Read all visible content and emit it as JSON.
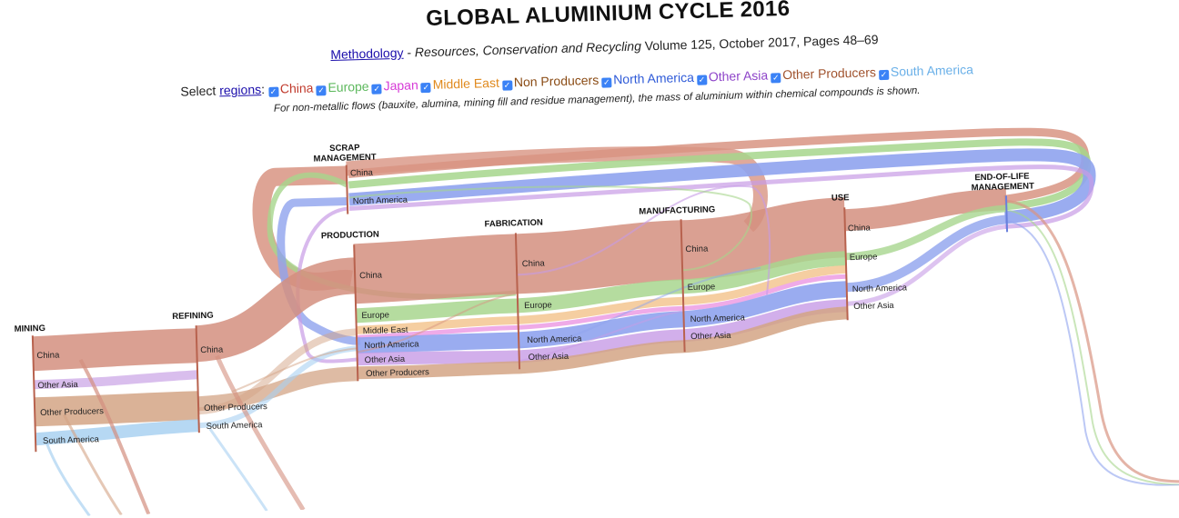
{
  "header": {
    "title": "GLOBAL ALUMINIUM CYCLE 2016",
    "methodology_link": "Methodology",
    "citation_journal": "Resources, Conservation and Recycling",
    "citation_rest": "Volume 125, October 2017, Pages 48–69",
    "select_label": "Select",
    "regions_link": "regions",
    "note": "For non-metallic flows (bauxite, alumina, mining fill and residue management), the mass of aluminium within chemical compounds is shown."
  },
  "regions": [
    {
      "label": "China",
      "color": "#c0392b",
      "checked": true
    },
    {
      "label": "Europe",
      "color": "#5cb85c",
      "checked": true
    },
    {
      "label": "Japan",
      "color": "#d63ad6",
      "checked": true
    },
    {
      "label": "Middle East",
      "color": "#e08a1e",
      "checked": true
    },
    {
      "label": "Non Producers",
      "color": "#8a4b14",
      "checked": true
    },
    {
      "label": "North America",
      "color": "#2f5bd8",
      "checked": true
    },
    {
      "label": "Other Asia",
      "color": "#8e44c9",
      "checked": true
    },
    {
      "label": "Other Producers",
      "color": "#a0522d",
      "checked": true
    },
    {
      "label": "South America",
      "color": "#6ab0e8",
      "checked": true
    }
  ],
  "stages": {
    "mining": "MINING",
    "refining": "REFINING",
    "scrap_1": "SCRAP",
    "scrap_2": "MANAGEMENT",
    "production": "PRODUCTION",
    "fabrication": "FABRICATION",
    "manufacturing": "MANUFACTURING",
    "use": "USE",
    "eol_1": "END-OF-LIFE",
    "eol_2": "MANAGEMENT"
  },
  "nodes": {
    "mining": [
      "China",
      "Other Asia",
      "Other Producers",
      "South America"
    ],
    "refining": [
      "China",
      "Other Producers",
      "South America"
    ],
    "scrap": [
      "China",
      "North America"
    ],
    "production": [
      "China",
      "Europe",
      "Middle East",
      "North America",
      "Other Asia",
      "Other Producers"
    ],
    "fabrication": [
      "China",
      "Europe",
      "North America",
      "Other Asia"
    ],
    "manufacturing": [
      "China",
      "Europe",
      "North America",
      "Other Asia"
    ],
    "use": [
      "China",
      "Europe",
      "North America",
      "Other Asia"
    ]
  }
}
